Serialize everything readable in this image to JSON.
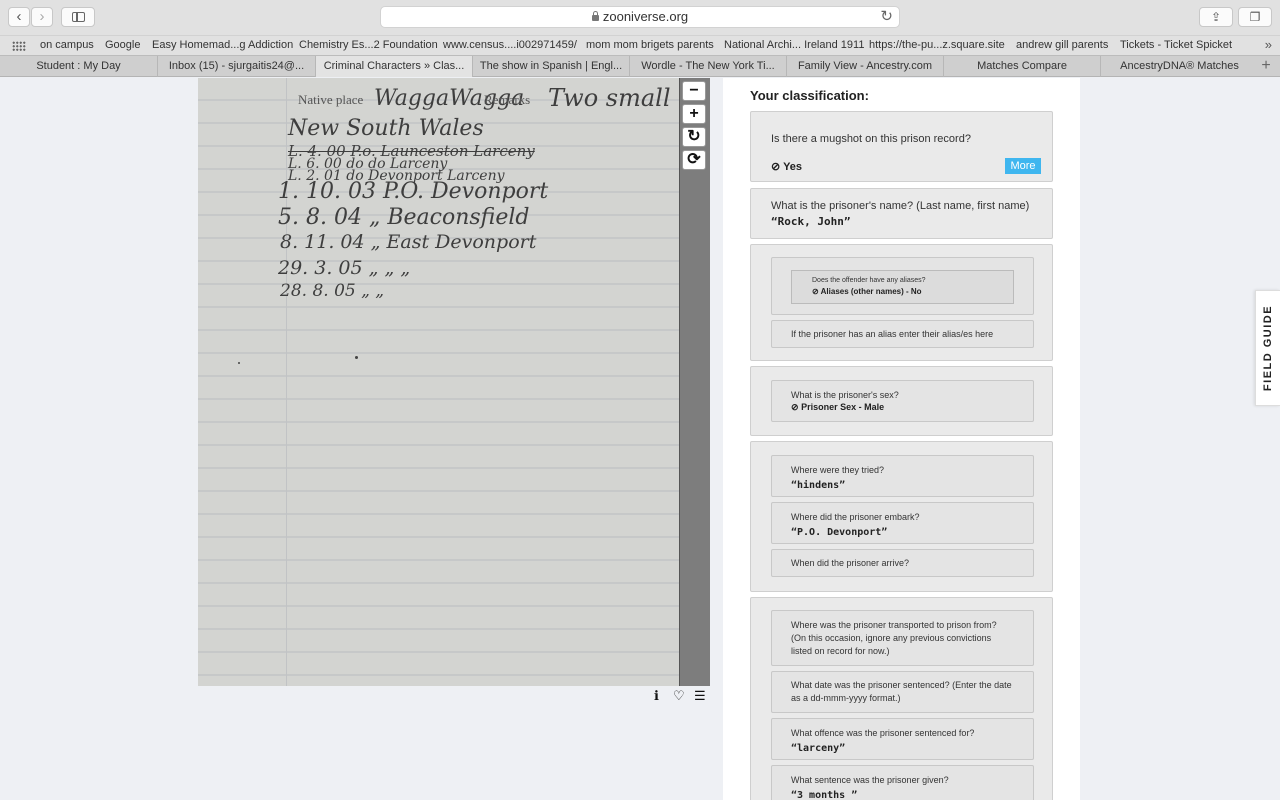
{
  "browser": {
    "url": "zooniverse.org",
    "bookmarks": [
      "on campus",
      "Google",
      "Easy Homemad...g Addiction",
      "Chemistry Es...2 Foundation",
      "www.census....i002971459/",
      "mom mom brigets parents",
      "National Archi... Ireland 1911",
      "https://the-pu...z.square.site",
      "andrew gill parents",
      "Tickets - Ticket Spicket"
    ],
    "tabs": [
      "Student : My Day",
      "Inbox (15) - sjurgaitis24@...",
      "Criminal Characters » Clas...",
      "The show in Spanish | Engl...",
      "Wordle - The New York Ti...",
      "Family View - Ancestry.com",
      "Matches Compare",
      "AncestryDNA® Matches"
    ],
    "active_tab": 2
  },
  "scan": {
    "printed_native": "Native place",
    "printed_remarks": "Remarks",
    "handwriting": [
      "WaggaWagga",
      "Two small",
      "New South Wales",
      "L. 4. 00  P.o. Launceston Larceny",
      "L. 6. 00  do  do  Larceny",
      "L. 2. 01  do Devonport Larceny",
      "1. 10. 03  P.O. Devonport",
      "5. 8. 04  „ Beaconsfield",
      "8. 11. 04  „ East Devonport",
      "29. 3. 05  „  „  „",
      "28. 8. 05  „  „"
    ]
  },
  "viewer_controls": {
    "zoom_out": "−",
    "zoom_in": "+",
    "rotate": "↻",
    "reset": "⟳"
  },
  "icons": [
    "info-icon",
    "heart-icon",
    "list-icon"
  ],
  "classification": {
    "title": "Your classification:",
    "mugshot": {
      "question": "Is there a mugshot on this prison record?",
      "answer": "Yes",
      "more": "More"
    },
    "name": {
      "question": "What is the prisoner's name? (Last name, first name)",
      "answer": "“Rock, John”"
    },
    "aliases": {
      "question": "Does the offender have any aliases?",
      "answer": "Aliases (other names) - No",
      "enter": "If the prisoner has an alias enter their alias/es here"
    },
    "sex": {
      "question": "What is the prisoner's sex?",
      "answer": "Prisoner Sex - Male"
    },
    "tried": {
      "question": "Where were they tried?",
      "answer": "“hindens”"
    },
    "embark": {
      "question": "Where did the prisoner embark?",
      "answer": "“P.O. Devonport”"
    },
    "arrive": {
      "question": "When did the prisoner arrive?"
    },
    "transported": {
      "question_lines": [
        "Where was the prisoner transported to prison from?",
        "(On this occasion, ignore any previous convictions",
        "listed on record for now.)"
      ]
    },
    "sentenced_date": {
      "question_lines": [
        "What date was the prisoner sentenced? (Enter the date",
        "as a dd-mmm-yyyy format.)"
      ]
    },
    "offence": {
      "question": "What offence was the prisoner sentenced for?",
      "answer": "“larceny”"
    },
    "sentence": {
      "question": "What sentence was the prisoner given?",
      "answer": "“3 months ”"
    }
  },
  "field_guide": "FIELD GUIDE"
}
